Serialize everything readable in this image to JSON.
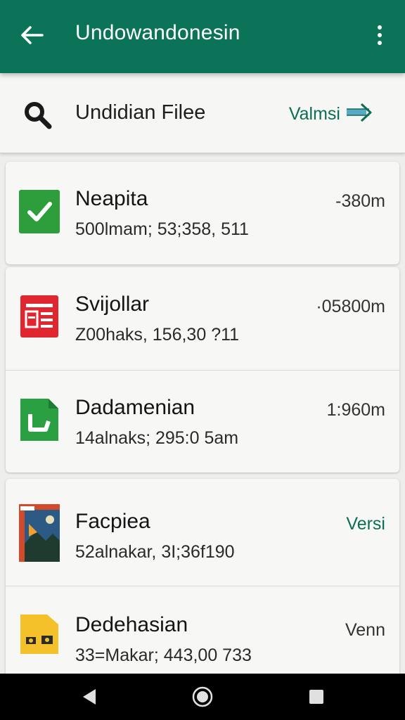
{
  "appbar": {
    "title": "Undowandonesin",
    "color": "#0b7358"
  },
  "search": {
    "label": "Undidian Filee",
    "action_label": "Valmsi"
  },
  "files": [
    {
      "name": "Neapita",
      "meta": "500lmam; 53;358, 511",
      "side": "-380m",
      "icon": "checkmark-doc-icon"
    },
    {
      "name": "Svijollar",
      "meta": "Z00haks, 156,30 ?11",
      "side": "·05800m",
      "icon": "pdf-doc-icon"
    },
    {
      "name": "Dadamenian",
      "meta": "14alnaks; 295:0 5am",
      "side": "1:960m",
      "icon": "sheet-doc-icon"
    },
    {
      "name": "Facpiea",
      "meta": "52alnakar, 3I;36f190",
      "side": "Versi",
      "icon": "image-thumb-icon"
    },
    {
      "name": "Dedehasian",
      "meta": "33=Makar; 443,00 733",
      "side": "Venn",
      "icon": "folder-image-icon"
    }
  ]
}
